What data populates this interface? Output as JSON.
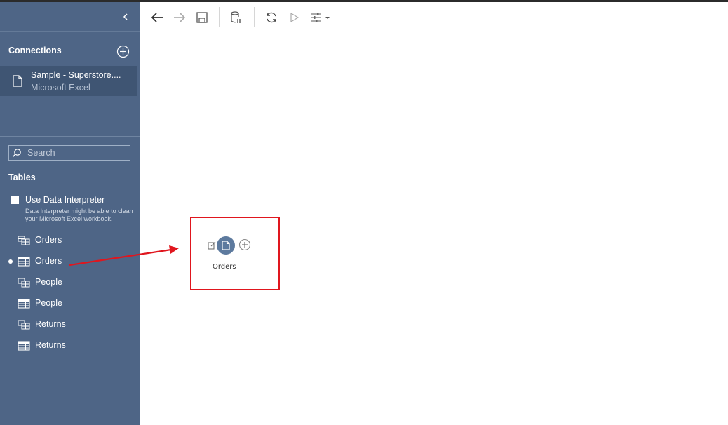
{
  "sidebar": {
    "connections_title": "Connections",
    "connection": {
      "name": "Sample - Superstore....",
      "type": "Microsoft Excel"
    },
    "search": {
      "placeholder": "Search"
    },
    "tables_title": "Tables",
    "data_interpreter": {
      "label": "Use Data Interpreter",
      "description": "Data Interpreter might be able to clean your Microsoft Excel workbook.",
      "checked": false
    },
    "tables": [
      {
        "label": "Orders",
        "icon": "named-range-icon",
        "active": false
      },
      {
        "label": "Orders",
        "icon": "table-grid-icon",
        "active": true
      },
      {
        "label": "People",
        "icon": "named-range-icon",
        "active": false
      },
      {
        "label": "People",
        "icon": "table-grid-icon",
        "active": false
      },
      {
        "label": "Returns",
        "icon": "named-range-icon",
        "active": false
      },
      {
        "label": "Returns",
        "icon": "table-grid-icon",
        "active": false
      }
    ]
  },
  "toolbar": {
    "buttons": [
      "back-arrow-icon",
      "forward-arrow-icon",
      "save-icon",
      "data-source-pause-icon",
      "refresh-icon",
      "run-icon",
      "settings-sliders-icon"
    ]
  },
  "canvas": {
    "node": {
      "label": "Orders",
      "icon": "file-icon"
    }
  },
  "colors": {
    "sidebar_bg": "#4e6586",
    "selected_connection_bg": "#3f5573",
    "node_fill": "#5d7a9e",
    "annotation_red": "#e0161e"
  }
}
